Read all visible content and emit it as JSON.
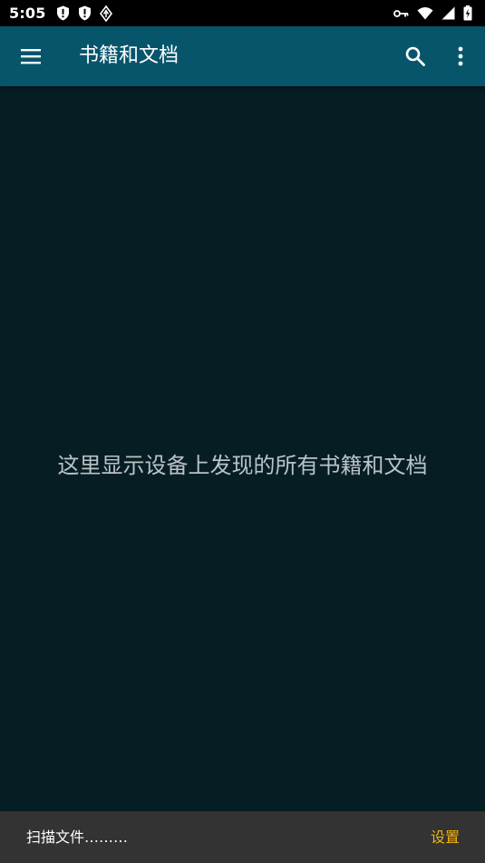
{
  "status_bar": {
    "time": "5:05",
    "left_icons": [
      "shield-alert-icon",
      "shield-alert-icon",
      "diamond-nav-icon"
    ],
    "right_icons": [
      "vpn-key-icon",
      "wifi-icon",
      "signal-icon",
      "battery-icon"
    ]
  },
  "app_bar": {
    "menu_icon": "menu-icon",
    "title": "书籍和文档",
    "search_icon": "search-icon",
    "more_icon": "more-vert-icon",
    "color": "#06556b"
  },
  "main": {
    "empty_message": "这里显示设备上发现的所有书籍和文档",
    "background": "#061d24"
  },
  "snackbar": {
    "message": "扫描文件………",
    "action_label": "设置",
    "action_color": "#f2b40c"
  }
}
